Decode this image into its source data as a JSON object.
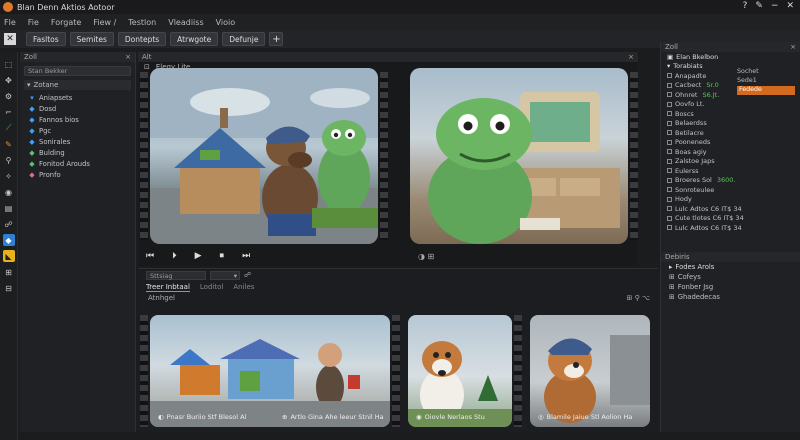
{
  "titlebar": {
    "title": "Blan Denn Aktios Aotoor"
  },
  "window_controls": [
    "?",
    "✎",
    "−",
    "✕"
  ],
  "menu": [
    "Fle",
    "Fie",
    "Forgate",
    "Fiew /",
    "Testlon",
    "Vleadiiss",
    "Vioio"
  ],
  "toolbar": {
    "buttons": [
      "Fasltos",
      "Semites",
      "Dontepts",
      "Atrwgote",
      "Defunje"
    ],
    "add": "+"
  },
  "outliner": {
    "header": "Zoll",
    "search_placeholder": "Stan Bekker",
    "subheader": "Zotane",
    "items": [
      {
        "label": "Aniapsets",
        "color": "#3fa0ff"
      },
      {
        "label": "Dosd",
        "color": "#3fa0ff"
      },
      {
        "label": "Fannos bios",
        "color": "#3fa0ff"
      },
      {
        "label": "Pgc",
        "color": "#3fa0ff"
      },
      {
        "label": "Sonirales",
        "color": "#3fa0ff"
      },
      {
        "label": "Bulding",
        "color": "#5cc66a"
      },
      {
        "label": "Fonitod Arouds",
        "color": "#5cc66a"
      },
      {
        "label": "Pronfo",
        "color": "#e06a8a"
      }
    ]
  },
  "viewport": {
    "header": "Alt",
    "label": "Elegy Lite",
    "play_controls": [
      "⏮",
      "⏵",
      "▶",
      "⏹",
      "⏭"
    ],
    "center_ctrl": "◑ ⊞"
  },
  "bottom_panel": {
    "search_placeholder": "Sttsiag",
    "dropdown": "▾",
    "tabs": [
      "Treer Inbtaal",
      "Loditol",
      "Aniles"
    ],
    "section": "Atnhgel",
    "thumbs": [
      "Pnasr Buriio Stf Blesol Al",
      "Artlo Gina Ahe leeur Stnil Ha",
      "Oiovle Nerlaos Stu",
      "Blamile Jaiue Stl Aolion Ha"
    ]
  },
  "details": {
    "header": "Zoll",
    "title": "Elan Bkelbon",
    "section": "Torabiats",
    "rows": [
      {
        "label": "Anapadte",
        "value": ""
      },
      {
        "label": "Cacbect",
        "value": "Sr.0"
      },
      {
        "label": "Ohnret",
        "value": "S6.Jt."
      },
      {
        "label": "Oovfo Lt.",
        "value": ""
      },
      {
        "label": "Boscs",
        "value": ""
      },
      {
        "label": "Belaerdss",
        "value": ""
      },
      {
        "label": "Betilacre",
        "value": ""
      },
      {
        "label": "Pooneneds",
        "value": ""
      },
      {
        "label": "Boas agiy",
        "value": ""
      },
      {
        "label": "Zalstoe Japs",
        "value": ""
      },
      {
        "label": "Eulerss",
        "value": ""
      },
      {
        "label": "Broeres Sol",
        "value": "3600."
      },
      {
        "label": "Sonroteulee",
        "value": ""
      },
      {
        "label": "Hody",
        "value": ""
      },
      {
        "label": "Lulc Adtos C6 IT$ 34",
        "value": ""
      },
      {
        "label": "Cute tlotes C6 IT$ 34",
        "value": ""
      },
      {
        "label": "Lulc Adtos C6 IT$ 34",
        "value": ""
      }
    ],
    "side": [
      "Sochet",
      "Sede1",
      "Fedede"
    ]
  },
  "timing": {
    "header": "Debiris",
    "subheader": "Fodes Arols",
    "rows": [
      "Cofeys",
      "Fonber Jsg",
      "Ghadedecas"
    ]
  }
}
